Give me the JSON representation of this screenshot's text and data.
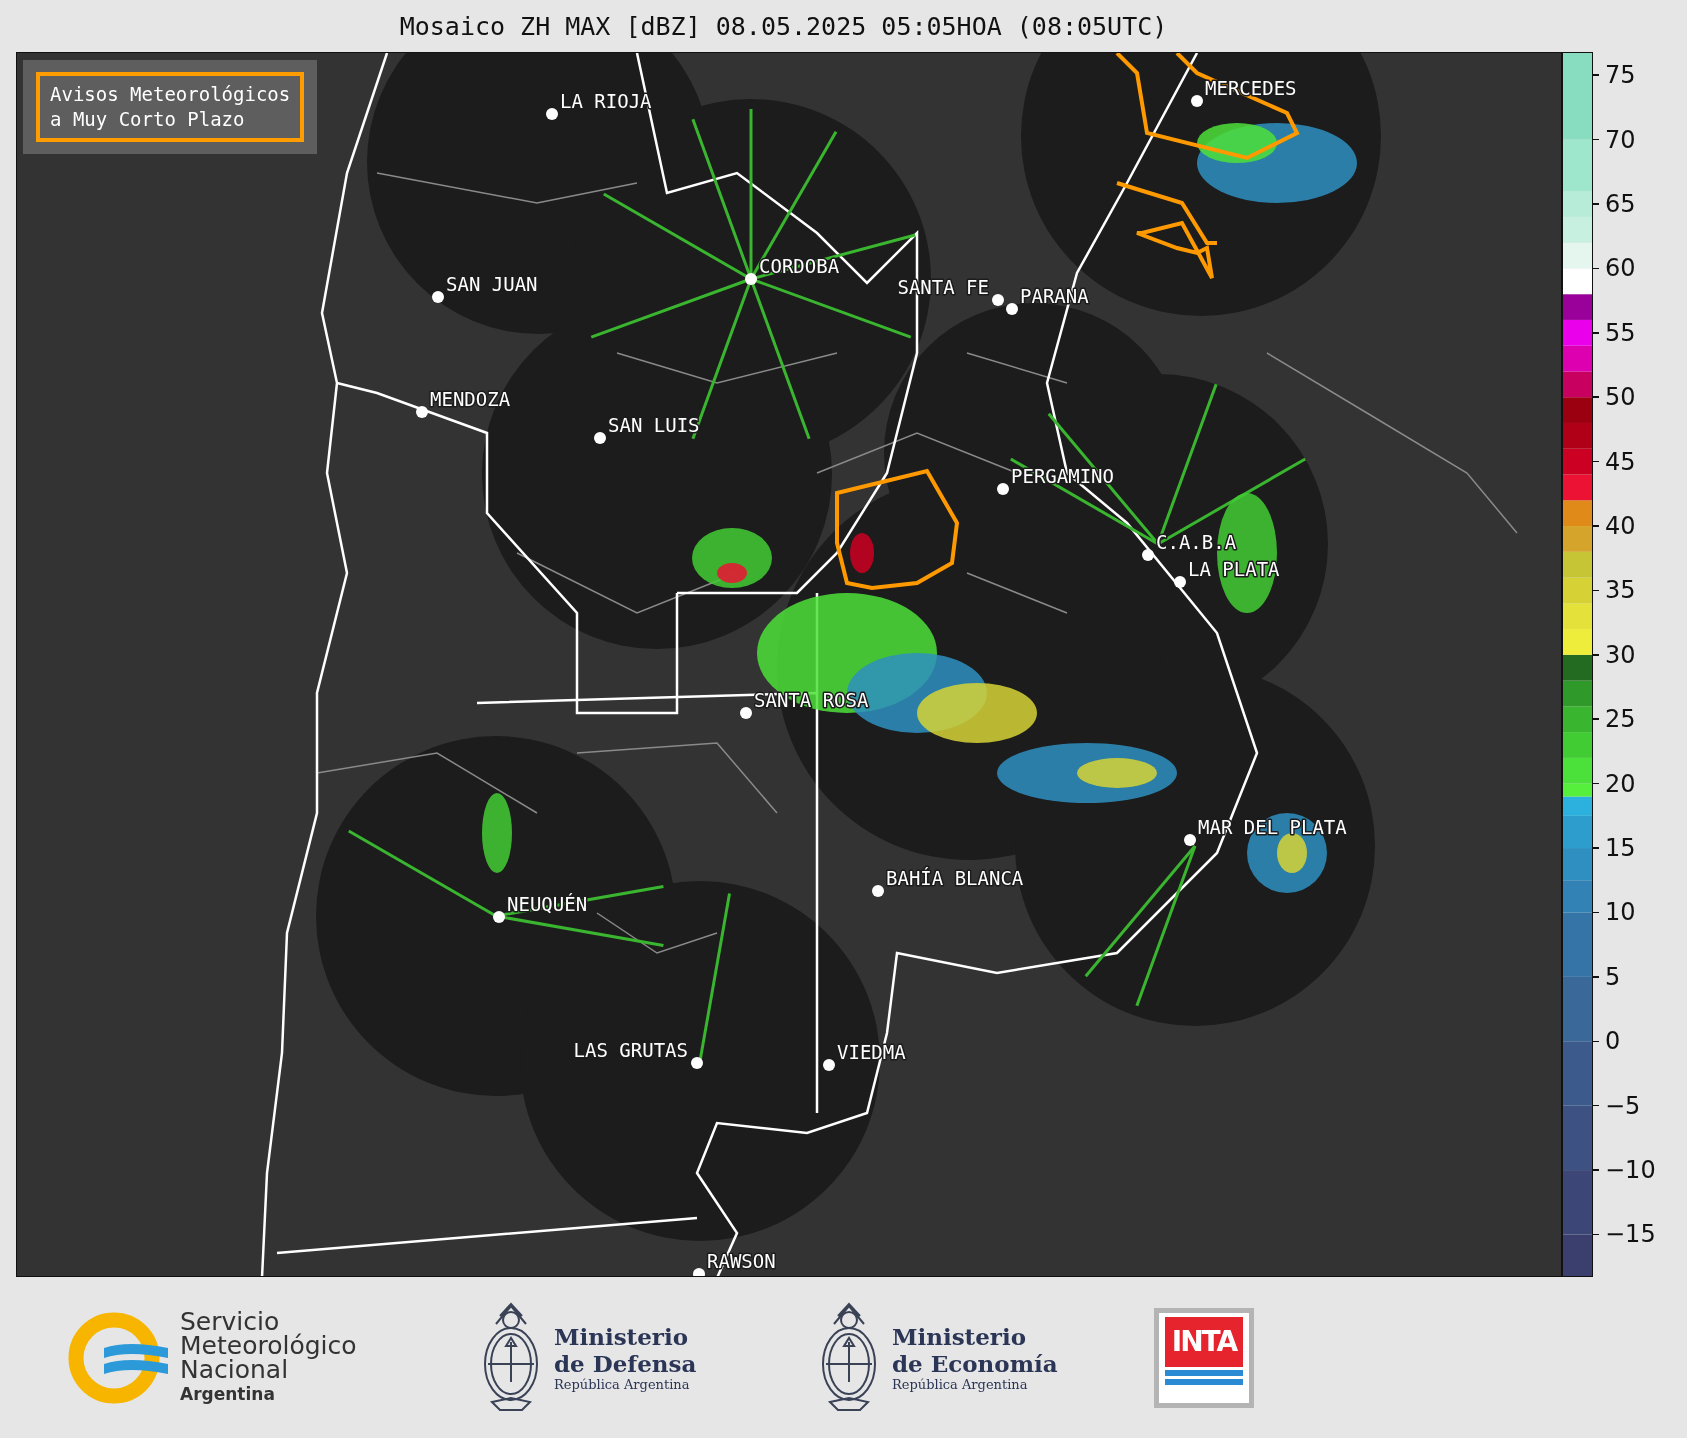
{
  "title": "Mosaico ZH MAX [dBZ] 08.05.2025 05:05HOA (08:05UTC)",
  "legend_box": {
    "lines": [
      "Avisos Meteorológicos",
      "a Muy Corto Plazo"
    ]
  },
  "cities": [
    {
      "name": "LA RIOJA"
    },
    {
      "name": "CORDOBA"
    },
    {
      "name": "SAN JUAN"
    },
    {
      "name": "SANTA FE"
    },
    {
      "name": "PARANA"
    },
    {
      "name": "MERCEDES"
    },
    {
      "name": "MENDOZA"
    },
    {
      "name": "SAN LUIS"
    },
    {
      "name": "PERGAMINO"
    },
    {
      "name": "C.A.B.A"
    },
    {
      "name": "LA PLATA"
    },
    {
      "name": "SANTA ROSA"
    },
    {
      "name": "MAR DEL PLATA"
    },
    {
      "name": "BAHÍA BLANCA"
    },
    {
      "name": "NEUQUÉN"
    },
    {
      "name": "LAS GRUTAS"
    },
    {
      "name": "VIEDMA"
    },
    {
      "name": "RAWSON"
    }
  ],
  "colorbar": {
    "ticks": [
      "75",
      "70",
      "65",
      "60",
      "55",
      "50",
      "45",
      "40",
      "35",
      "30",
      "25",
      "20",
      "15",
      "10",
      "5",
      "0",
      "−5",
      "−10",
      "−15"
    ]
  },
  "footer": {
    "smn": {
      "lines": [
        "Servicio",
        "Meteorológico",
        "Nacional"
      ],
      "country": "Argentina"
    },
    "ministries": [
      {
        "lines": [
          "Ministerio",
          "de Defensa"
        ],
        "subtitle": "República Argentina"
      },
      {
        "lines": [
          "Ministerio",
          "de Economía"
        ],
        "subtitle": "República Argentina"
      }
    ],
    "inta": "INTA"
  }
}
